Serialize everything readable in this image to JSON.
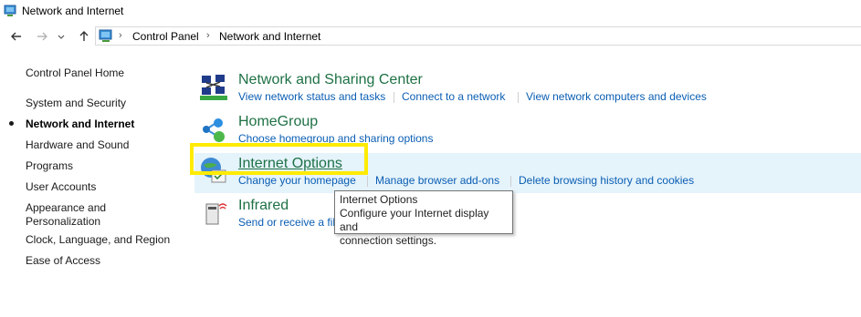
{
  "window": {
    "title": "Network and Internet"
  },
  "address_bar": {
    "crumbs": [
      "Control Panel",
      "Network and Internet"
    ]
  },
  "sidebar": {
    "home": "Control Panel Home",
    "items": [
      {
        "label": "System and Security",
        "active": false
      },
      {
        "label": "Network and Internet",
        "active": true
      },
      {
        "label": "Hardware and Sound",
        "active": false
      },
      {
        "label": "Programs",
        "active": false
      },
      {
        "label": "User Accounts",
        "active": false
      },
      {
        "label": "Appearance and Personalization",
        "active": false
      },
      {
        "label": "Clock, Language, and Region",
        "active": false
      },
      {
        "label": "Ease of Access",
        "active": false
      }
    ]
  },
  "categories": [
    {
      "title": "Network and Sharing Center",
      "icon": "network-sharing-icon",
      "links": [
        "View network status and tasks",
        "Connect to a network",
        "View network computers and devices"
      ]
    },
    {
      "title": "HomeGroup",
      "icon": "homegroup-icon",
      "links": [
        "Choose homegroup and sharing options"
      ]
    },
    {
      "title": "Internet Options",
      "icon": "internet-options-icon",
      "links": [
        "Change your homepage",
        "Manage browser add-ons",
        "Delete browsing history and cookies"
      ]
    },
    {
      "title": "Infrared",
      "icon": "infrared-icon",
      "links": [
        "Send or receive a file"
      ]
    }
  ],
  "tooltip": {
    "title": "Internet Options",
    "line1": "Configure your Internet display and",
    "line2": "connection settings."
  },
  "colors": {
    "category_title": "#1e7145",
    "link": "#0a5eb3",
    "highlight": "#ffeb00",
    "hover_band": "#e5f3fb"
  }
}
